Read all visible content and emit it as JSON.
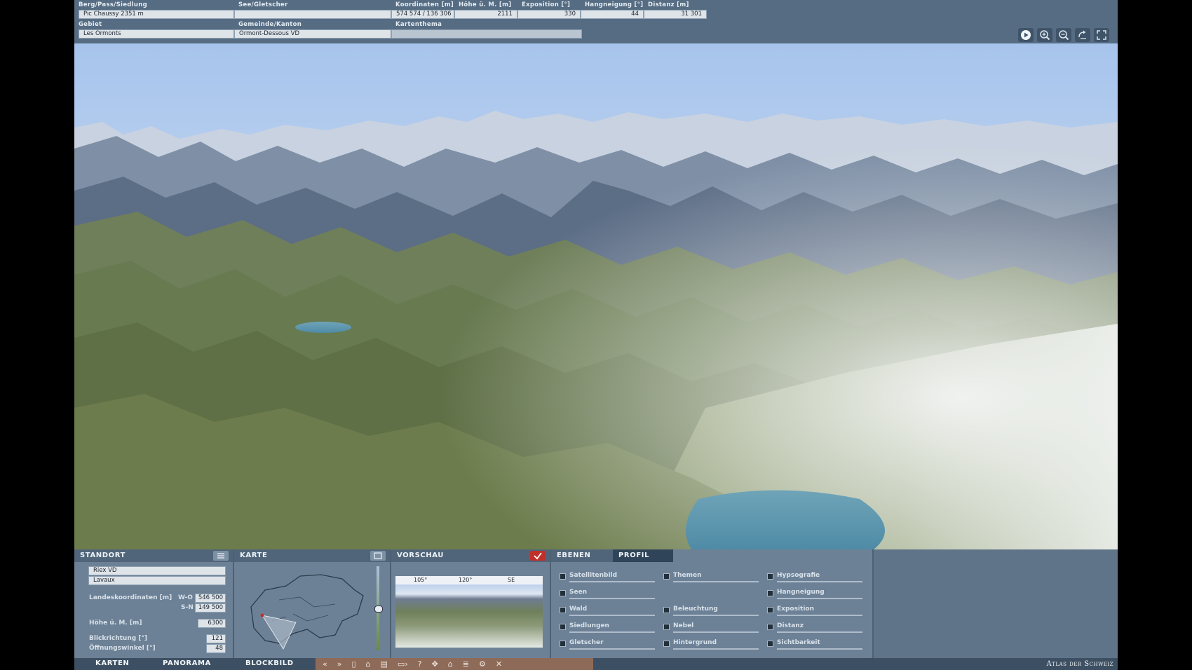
{
  "topbar": {
    "berg": {
      "label": "Berg/Pass/Siedlung",
      "value": "Pic Chaussy   2351 m"
    },
    "see": {
      "label": "See/Gletscher",
      "value": ""
    },
    "koord": {
      "label": "Koordinaten [m]",
      "value": "574 574 / 136 306"
    },
    "hoehe": {
      "label": "Höhe ü. M. [m]",
      "value": "2111"
    },
    "expo": {
      "label": "Exposition [°]",
      "value": "330"
    },
    "hang": {
      "label": "Hangneigung [°]",
      "value": "44"
    },
    "dist": {
      "label": "Distanz [m]",
      "value": "31 301"
    },
    "gebiet": {
      "label": "Gebiet",
      "value": "Les Ormonts"
    },
    "gemeinde": {
      "label": "Gemeinde/Kanton",
      "value": "Ormont-Dessous   VD"
    },
    "thema": {
      "label": "Kartenthema",
      "value": ""
    }
  },
  "controls": [
    "play-icon",
    "zoom-in-icon",
    "zoom-out-icon",
    "rotate-icon",
    "fullscreen-icon"
  ],
  "standort": {
    "title": "STANDORT",
    "place1": "Riex   VD",
    "place2": "Lavaux",
    "koord_label": "Landeskoordinaten [m]",
    "wo_label": "W-O",
    "wo_value": "546 500",
    "sn_label": "S-N",
    "sn_value": "149 500",
    "hoehe_label": "Höhe ü. M. [m]",
    "hoehe_value": "6300",
    "blick_label": "Blickrichtung [°]",
    "blick_value": "121",
    "oeffnung_label": "Öffnungswinkel [°]",
    "oeffnung_value": "48"
  },
  "karte": {
    "title": "KARTE"
  },
  "vorschau": {
    "title": "VORSCHAU",
    "ticks": [
      "105°",
      "120°",
      "SE"
    ]
  },
  "ebenen": {
    "tab_ebenen": "EBENEN",
    "tab_profil": "PROFIL",
    "col1": [
      "Satellitenbild",
      "Seen",
      "Wald",
      "Siedlungen",
      "Gletscher"
    ],
    "col2": [
      "Themen",
      "Beleuchtung",
      "Nebel",
      "Hintergrund"
    ],
    "col3": [
      "Hypsografie",
      "Hangneigung",
      "Exposition",
      "Distanz",
      "Sichtbarkeit"
    ]
  },
  "footer": {
    "tab_karten": "KARTEN",
    "tab_panorama": "PANORAMA",
    "tab_blockbild": "BLOCKBILD",
    "brand": "Atlas der Schweiz"
  },
  "colors": {
    "panel": "#6d8196",
    "header": "#50657a",
    "accent": "#c0302a",
    "toolbar": "#8e6a58"
  }
}
